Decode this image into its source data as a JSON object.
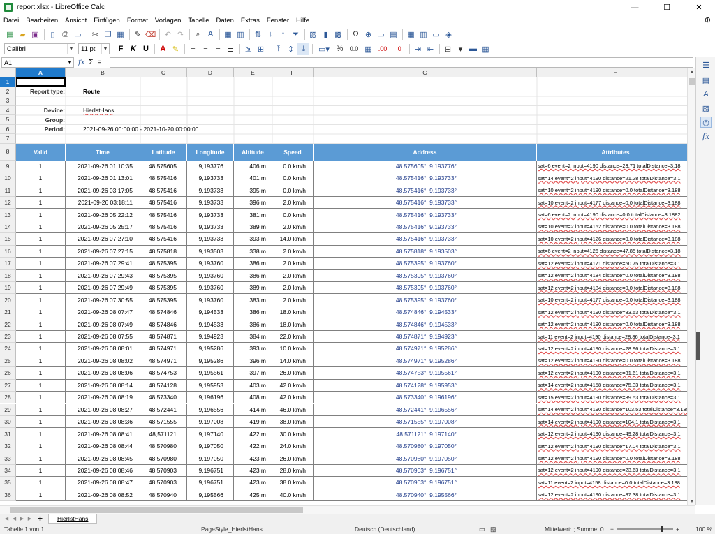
{
  "window": {
    "title": "report.xlsx - LibreOffice Calc",
    "controls": [
      "—",
      "☐",
      "✕"
    ]
  },
  "menu": [
    "Datei",
    "Bearbeiten",
    "Ansicht",
    "Einfügen",
    "Format",
    "Vorlagen",
    "Tabelle",
    "Daten",
    "Extras",
    "Fenster",
    "Hilfe"
  ],
  "format_bar": {
    "font_name": "Calibri",
    "font_size": "11 pt",
    "bold": "F",
    "italic": "K",
    "underline": "U",
    "percent": "%",
    "decimal": "0.0"
  },
  "formula_bar": {
    "cell_ref": "A1",
    "fx": "fx",
    "sigma": "Σ",
    "equals": "=",
    "content": ""
  },
  "grid": {
    "columns": [
      "A",
      "B",
      "C",
      "D",
      "E",
      "F",
      "G",
      "H"
    ],
    "active_column": "A",
    "active_row": "1",
    "row_numbers": [
      "1",
      "2",
      "3",
      "4",
      "5",
      "6",
      "7",
      "8",
      "9",
      "10",
      "11",
      "12",
      "13",
      "14",
      "15",
      "16",
      "17",
      "18",
      "19",
      "20",
      "21",
      "22",
      "23",
      "24",
      "25",
      "26",
      "27",
      "28",
      "29",
      "30",
      "31",
      "32",
      "33",
      "34",
      "35",
      "36"
    ]
  },
  "report": {
    "type_label": "Report type:",
    "type_value": "Route",
    "device_label": "Device:",
    "device_value": "HierIstHans",
    "group_label": "Group:",
    "period_label": "Period:",
    "period_value": "2021-09-26 00:00:00 - 2021-10-20 00:00:00"
  },
  "table": {
    "headers": [
      "Valid",
      "Time",
      "Latitude",
      "Longitude",
      "Altitude",
      "Speed",
      "Address",
      "Attributes"
    ],
    "rows": [
      [
        "1",
        "2021-09-26 01:10:35",
        "48,575605",
        "9,193776",
        "406 m",
        "0.0 km/h",
        "48.575605°, 9.193776°",
        "sat=6  event=2  input=4190  distance=23.71  totalDistance=3.18"
      ],
      [
        "1",
        "2021-09-26 01:13:01",
        "48,575416",
        "9,193733",
        "401 m",
        "0.0 km/h",
        "48.575416°, 9.193733°",
        "sat=14  event=2  input=4190  distance=21.28  totalDistance=3.1"
      ],
      [
        "1",
        "2021-09-26 03:17:05",
        "48,575416",
        "9,193733",
        "395 m",
        "0.0 km/h",
        "48.575416°, 9.193733°",
        "sat=10  event=2  input=4190  distance=0.0  totalDistance=3.188"
      ],
      [
        "1",
        "2021-09-26 03:18:11",
        "48,575416",
        "9,193733",
        "396 m",
        "2.0 km/h",
        "48.575416°, 9.193733°",
        "sat=10  event=2  input=4177  distance=0.0  totalDistance=3.188"
      ],
      [
        "1",
        "2021-09-26 05:22:12",
        "48,575416",
        "9,193733",
        "381 m",
        "0.0 km/h",
        "48.575416°, 9.193733°",
        "sat=6  event=2  input=4190  distance=0.0  totalDistance=3.1882"
      ],
      [
        "1",
        "2021-09-26 05:25:17",
        "48,575416",
        "9,193733",
        "389 m",
        "2.0 km/h",
        "48.575416°, 9.193733°",
        "sat=10  event=2  input=4152  distance=0.0  totalDistance=3.188"
      ],
      [
        "1",
        "2021-09-26 07:27:10",
        "48,575416",
        "9,193733",
        "393 m",
        "14.0 km/h",
        "48.575416°, 9.193733°",
        "sat=10  event=2  input=4126  distance=0.0  totalDistance=3.188"
      ],
      [
        "1",
        "2021-09-26 07:27:15",
        "48,575818",
        "9,193503",
        "338 m",
        "2.0 km/h",
        "48.575818°, 9.193503°",
        "sat=6  event=2  input=4126  distance=47.85  totalDistance=3.18"
      ],
      [
        "1",
        "2021-09-26 07:29:41",
        "48,575395",
        "9,193760",
        "386 m",
        "2.0 km/h",
        "48.575395°, 9.193760°",
        "sat=12  event=2  input=4171  distance=50.75  totalDistance=3.1"
      ],
      [
        "1",
        "2021-09-26 07:29:43",
        "48,575395",
        "9,193760",
        "386 m",
        "2.0 km/h",
        "48.575395°, 9.193760°",
        "sat=12  event=2  input=4184  distance=0.0  totalDistance=3.188"
      ],
      [
        "1",
        "2021-09-26 07:29:49",
        "48,575395",
        "9,193760",
        "389 m",
        "2.0 km/h",
        "48.575395°, 9.193760°",
        "sat=12  event=2  input=4184  distance=0.0  totalDistance=3.188"
      ],
      [
        "1",
        "2021-09-26 07:30:55",
        "48,575395",
        "9,193760",
        "383 m",
        "2.0 km/h",
        "48.575395°, 9.193760°",
        "sat=10  event=2  input=4177  distance=0.0  totalDistance=3.188"
      ],
      [
        "1",
        "2021-09-26 08:07:47",
        "48,574846",
        "9,194533",
        "386 m",
        "18.0 km/h",
        "48.574846°, 9.194533°",
        "sat=12  event=2  input=4190  distance=83.53  totalDistance=3.1"
      ],
      [
        "1",
        "2021-09-26 08:07:49",
        "48,574846",
        "9,194533",
        "386 m",
        "18.0 km/h",
        "48.574846°, 9.194533°",
        "sat=12  event=2  input=4190  distance=0.0  totalDistance=3.188"
      ],
      [
        "1",
        "2021-09-26 08:07:55",
        "48,574871",
        "9,194923",
        "384 m",
        "22.0 km/h",
        "48.574871°, 9.194923°",
        "sat=11  event=2  input=4190  distance=28.86  totalDistance=3.1"
      ],
      [
        "1",
        "2021-09-26 08:08:01",
        "48,574971",
        "9,195286",
        "393 m",
        "10.0 km/h",
        "48.574971°, 9.195286°",
        "sat=12  event=2  input=4190  distance=28.96  totalDistance=3.1"
      ],
      [
        "1",
        "2021-09-26 08:08:02",
        "48,574971",
        "9,195286",
        "396 m",
        "14.0 km/h",
        "48.574971°, 9.195286°",
        "sat=12  event=2  input=4190  distance=0.0  totalDistance=3.188"
      ],
      [
        "1",
        "2021-09-26 08:08:06",
        "48,574753",
        "9,195561",
        "397 m",
        "26.0 km/h",
        "48.574753°, 9.195561°",
        "sat=12  event=2  input=4190  distance=31.61  totalDistance=3.1"
      ],
      [
        "1",
        "2021-09-26 08:08:14",
        "48,574128",
        "9,195953",
        "403 m",
        "42.0 km/h",
        "48.574128°, 9.195953°",
        "sat=14  event=2  input=4158  distance=75.33  totalDistance=3.1"
      ],
      [
        "1",
        "2021-09-26 08:08:19",
        "48,573340",
        "9,196196",
        "408 m",
        "42.0 km/h",
        "48.573340°, 9.196196°",
        "sat=15  event=2  input=4190  distance=89.53  totalDistance=3.1"
      ],
      [
        "1",
        "2021-09-26 08:08:27",
        "48,572441",
        "9,196556",
        "414 m",
        "46.0 km/h",
        "48.572441°, 9.196556°",
        "sat=14  event=2  input=4190  distance=103.53  totalDistance=3.188"
      ],
      [
        "1",
        "2021-09-26 08:08:36",
        "48,571555",
        "9,197008",
        "419 m",
        "38.0 km/h",
        "48.571555°, 9.197008°",
        "sat=14  event=2  input=4190  distance=104.1  totalDistance=3.1"
      ],
      [
        "1",
        "2021-09-26 08:08:41",
        "48,571121",
        "9,197140",
        "422 m",
        "30.0 km/h",
        "48.571121°, 9.197140°",
        "sat=12  event=2  input=4190  distance=49.28  totalDistance=3.1"
      ],
      [
        "1",
        "2021-09-26 08:08:44",
        "48,570980",
        "9,197050",
        "422 m",
        "24.0 km/h",
        "48.570980°, 9.197050°",
        "sat=12  event=2  input=4190  distance=17.04  totalDistance=3.1"
      ],
      [
        "1",
        "2021-09-26 08:08:45",
        "48,570980",
        "9,197050",
        "423 m",
        "26.0 km/h",
        "48.570980°, 9.197050°",
        "sat=12  event=2  input=4190  distance=0.0  totalDistance=3.188"
      ],
      [
        "1",
        "2021-09-26 08:08:46",
        "48,570903",
        "9,196751",
        "423 m",
        "28.0 km/h",
        "48.570903°, 9.196751°",
        "sat=12  event=2  input=4190  distance=23.63  totalDistance=3.1"
      ],
      [
        "1",
        "2021-09-26 08:08:47",
        "48,570903",
        "9,196751",
        "423 m",
        "38.0 km/h",
        "48.570903°, 9.196751°",
        "sat=11  event=2  input=4158  distance=0.0  totalDistance=3.188"
      ],
      [
        "1",
        "2021-09-26 08:08:52",
        "48,570940",
        "9,195566",
        "425 m",
        "40.0 km/h",
        "48.570940°, 9.195566°",
        "sat=12  event=2  input=4190  distance=87.38  totalDistance=3.1"
      ]
    ]
  },
  "sheet_tabs": {
    "active": "HierIstHans",
    "add": "+"
  },
  "status": {
    "sheet": "Tabelle 1 von 1",
    "page_style": "PageStyle_HierIstHans",
    "language": "Deutsch (Deutschland)",
    "summary": "Mittelwert: ; Summe: 0",
    "zoom": "100 %"
  },
  "icons": [
    "new-icon",
    "open-icon",
    "save-icon",
    "export-pdf-icon",
    "print-icon",
    "print-preview-icon",
    "cut-icon",
    "copy-icon",
    "paste-icon",
    "clone-icon",
    "clear-icon",
    "undo-icon",
    "redo-icon",
    "find-icon",
    "spelling-icon",
    "row-icon",
    "column-icon",
    "sort-icon",
    "sort-asc-icon",
    "sort-desc-icon",
    "autofilter-icon",
    "image-icon",
    "chart-icon",
    "pivot-icon",
    "special-char-icon",
    "hyperlink-icon",
    "comment-icon",
    "header-footer-icon",
    "define-print-area-icon",
    "freeze-icon",
    "split-icon",
    "show-draw-icon"
  ]
}
